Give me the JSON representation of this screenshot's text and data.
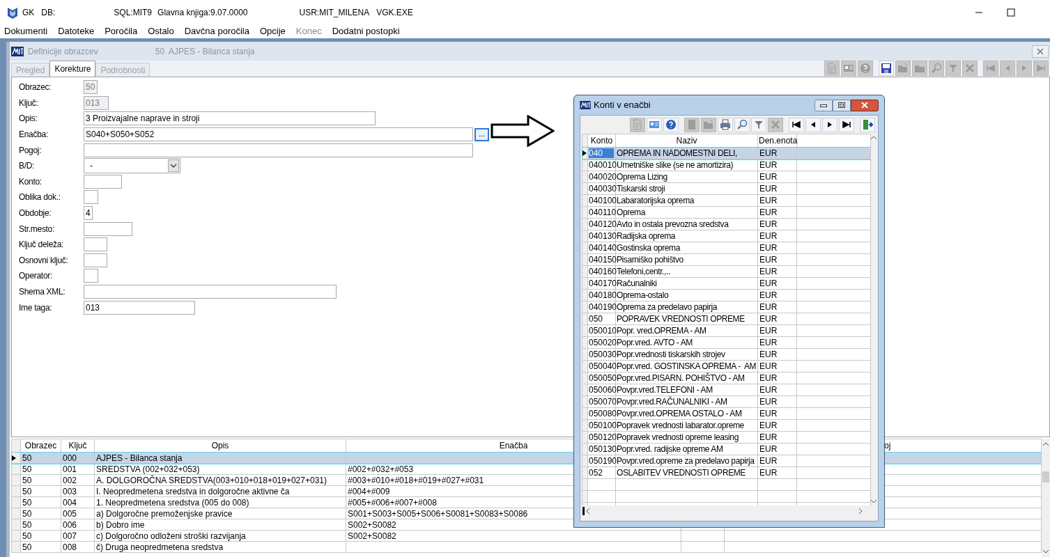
{
  "app_window": {
    "title_parts": [
      "GK",
      "DB:",
      "SQL:MIT9",
      "Glavna knjiga:9.07.0000",
      "USR:MIT_MILENA",
      "VGK.EXE"
    ]
  },
  "menu": [
    {
      "label": "Dokumenti",
      "disabled": false
    },
    {
      "label": "Datoteke",
      "disabled": false
    },
    {
      "label": "Poročila",
      "disabled": false
    },
    {
      "label": "Ostalo",
      "disabled": false
    },
    {
      "label": "Davčna poročila",
      "disabled": false
    },
    {
      "label": "Opcije",
      "disabled": false
    },
    {
      "label": "Konec",
      "disabled": true
    },
    {
      "label": "Dodatni postopki",
      "disabled": false
    }
  ],
  "child_window": {
    "title": "Definicije obrazcev",
    "subtitle": "50  AJPES - Bilanca stanja",
    "tabs": [
      {
        "label": "Pregled",
        "selected": false,
        "disabled": true
      },
      {
        "label": "Korekture",
        "selected": true,
        "disabled": false
      },
      {
        "label": "Podrobnosti",
        "selected": false,
        "disabled": true
      }
    ],
    "toolbar_groups": [
      {
        "buttons": [
          {
            "kind": "document",
            "disabled": true
          },
          {
            "kind": "card",
            "disabled": true
          },
          {
            "kind": "help",
            "disabled": true
          }
        ]
      },
      {
        "buttons": [
          {
            "kind": "save",
            "disabled": false
          },
          {
            "kind": "folder_open",
            "disabled": true
          },
          {
            "kind": "folder",
            "disabled": true
          },
          {
            "kind": "search",
            "disabled": true
          },
          {
            "kind": "filter",
            "disabled": true
          },
          {
            "kind": "delete",
            "disabled": true
          }
        ]
      },
      {
        "buttons": [
          {
            "kind": "first",
            "disabled": true
          },
          {
            "kind": "prev",
            "disabled": true
          },
          {
            "kind": "next",
            "disabled": true
          },
          {
            "kind": "last",
            "disabled": true
          }
        ]
      }
    ]
  },
  "form": {
    "fields": [
      {
        "label": "Obrazec:",
        "value": "50",
        "kind": "text",
        "readonly": true
      },
      {
        "label": "Ključ:",
        "value": "013",
        "kind": "text",
        "readonly": true
      },
      {
        "label": "Opis:",
        "value": "3 Proizvajalne naprave in stroji",
        "kind": "text",
        "readonly": false
      },
      {
        "label": "Enačba:",
        "value": "S040+S050+S052",
        "kind": "text_button",
        "button_label": "...",
        "readonly": false
      },
      {
        "label": "Pogoj:",
        "kind": "text",
        "readonly": false
      },
      {
        "label": "B/D:",
        "value": "-",
        "kind": "combo",
        "readonly": false
      },
      {
        "label": "Konto:",
        "kind": "text",
        "readonly": false
      },
      {
        "label": "Oblika dok.:",
        "kind": "text",
        "readonly": false
      },
      {
        "label": "Obdobje:",
        "value": "4",
        "kind": "text",
        "readonly": false
      },
      {
        "label": "Str.mesto:",
        "kind": "text",
        "readonly": false
      },
      {
        "label": "Ključ deleža:",
        "kind": "text",
        "readonly": false
      },
      {
        "label": "Osnovni ključ:",
        "kind": "text",
        "readonly": false
      },
      {
        "label": "Operator:",
        "kind": "text",
        "readonly": false
      },
      {
        "label": "Shema XML:",
        "kind": "text",
        "readonly": false
      },
      {
        "label": "Ime taga:",
        "value": "013",
        "kind": "text",
        "readonly": false
      }
    ]
  },
  "grid": {
    "columns": [
      "Obrazec",
      "Ključ",
      "Opis",
      "Enačba"
    ],
    "column_6_header": "oj",
    "rows": [
      {
        "obrazec": "50",
        "kljuc": "000",
        "opis": "AJPES - Bilanca stanja",
        "selected": true
      },
      {
        "obrazec": "50",
        "kljuc": "001",
        "opis": "SREDSTVA (002+032+053)",
        "enacba": "#002+#032+#053",
        "selected": false
      },
      {
        "obrazec": "50",
        "kljuc": "002",
        "opis": "A. DOLGOROČNA SREDSTVA(003+010+018+019+027+031)",
        "enacba": "#003+#010+#018+#019+#027+#031",
        "selected": false
      },
      {
        "obrazec": "50",
        "kljuc": "003",
        "opis": "I. Neopredmetena sredstva in dolgoročne aktivne ča",
        "enacba": "#004+#009",
        "selected": false
      },
      {
        "obrazec": "50",
        "kljuc": "004",
        "opis": "1. Neopredmetena sredstva (005 do 008)",
        "enacba": "#005+#006+#007+#008",
        "selected": false
      },
      {
        "obrazec": "50",
        "kljuc": "005",
        "opis": "a) Dolgoročne premoženjske pravice",
        "enacba": "S001+S003+S005+S006+S0081+S0083+S0086",
        "selected": false
      },
      {
        "obrazec": "50",
        "kljuc": "006",
        "opis": "b) Dobro ime",
        "enacba": "S002+S0082",
        "selected": false
      },
      {
        "obrazec": "50",
        "kljuc": "007",
        "opis": "c) Dolgoročno odloženi stroški razvijanja",
        "enacba": "S002+S0082",
        "selected": false
      },
      {
        "obrazec": "50",
        "kljuc": "008",
        "opis": "č) Druga neopredmetena sredstva",
        "selected": false
      }
    ]
  },
  "dialog": {
    "title": "Konti v enačbi",
    "toolbar_groups": [
      {
        "buttons": [
          {
            "kind": "document",
            "disabled": true
          },
          {
            "kind": "card",
            "disabled": false
          },
          {
            "kind": "help",
            "disabled": false
          }
        ]
      },
      {
        "buttons": [
          {
            "kind": "new",
            "disabled": true
          },
          {
            "kind": "folder_open",
            "disabled": true
          },
          {
            "kind": "print",
            "disabled": false
          },
          {
            "kind": "search",
            "disabled": false
          },
          {
            "kind": "filter",
            "disabled": false
          },
          {
            "kind": "delete",
            "disabled": true
          }
        ]
      },
      {
        "buttons": [
          {
            "kind": "first",
            "disabled": false
          },
          {
            "kind": "prev",
            "disabled": false
          },
          {
            "kind": "next",
            "disabled": false
          },
          {
            "kind": "last",
            "disabled": false
          }
        ]
      },
      {
        "buttons": [
          {
            "kind": "exit",
            "disabled": false
          }
        ]
      }
    ],
    "columns": [
      "Konto",
      "Naziv",
      "Den.enota"
    ],
    "rows": [
      {
        "konto": "040",
        "naziv": "OPREMA IN NADOMESTNI DELI,",
        "enota": "EUR",
        "selected": true
      },
      {
        "konto": "040010",
        "naziv": "Umetniške slike (se ne amortizira)",
        "enota": "EUR",
        "selected": false
      },
      {
        "konto": "040020",
        "naziv": "Oprema Lizing",
        "enota": "EUR",
        "selected": false
      },
      {
        "konto": "040030",
        "naziv": "Tiskarski stroji",
        "enota": "EUR",
        "selected": false
      },
      {
        "konto": "040100",
        "naziv": "Labaratorijska oprema",
        "enota": "EUR",
        "selected": false
      },
      {
        "konto": "040110",
        "naziv": "Oprema",
        "enota": "EUR",
        "selected": false
      },
      {
        "konto": "040120",
        "naziv": "Avto in ostala prevozna sredstva",
        "enota": "EUR",
        "selected": false
      },
      {
        "konto": "040130",
        "naziv": "Radijska oprema",
        "enota": "EUR",
        "selected": false
      },
      {
        "konto": "040140",
        "naziv": "Gostinska oprema",
        "enota": "EUR",
        "selected": false
      },
      {
        "konto": "040150",
        "naziv": "Pisarniško pohištvo",
        "enota": "EUR",
        "selected": false
      },
      {
        "konto": "040160",
        "naziv": "Telefoni,centr.,..",
        "enota": "EUR",
        "selected": false
      },
      {
        "konto": "040170",
        "naziv": "Računalniki",
        "enota": "EUR",
        "selected": false
      },
      {
        "konto": "040180",
        "naziv": "Oprema-ostalo",
        "enota": "EUR",
        "selected": false
      },
      {
        "konto": "040190",
        "naziv": "Oprema za predelavo papirja",
        "enota": "EUR",
        "selected": false
      },
      {
        "konto": "050",
        "naziv": "POPRAVEK VREDNOSTI OPREME",
        "enota": "EUR",
        "selected": false
      },
      {
        "konto": "050010",
        "naziv": "Popr. vred.OPREMA - AM",
        "enota": "EUR",
        "selected": false
      },
      {
        "konto": "050020",
        "naziv": "Popr.vred. AVTO - AM",
        "enota": "EUR",
        "selected": false
      },
      {
        "konto": "050030",
        "naziv": "Popr.vrednosti tiskarskih strojev",
        "enota": "EUR",
        "selected": false
      },
      {
        "konto": "050040",
        "naziv": "Popr.vred. GOSTINSKA OPREMA -  AM",
        "enota": "EUR",
        "selected": false
      },
      {
        "konto": "050050",
        "naziv": "Popr.vred.PISARN. POHIŠTVO - AM",
        "enota": "EUR",
        "selected": false
      },
      {
        "konto": "050060",
        "naziv": "Povpr.vred.TELEFONI - AM",
        "enota": "EUR",
        "selected": false
      },
      {
        "konto": "050070",
        "naziv": "Povpr.vred.RAČUNALNIKI - AM",
        "enota": "EUR",
        "selected": false
      },
      {
        "konto": "050080",
        "naziv": "Povpr.vred.OPREMA OSTALO - AM",
        "enota": "EUR",
        "selected": false
      },
      {
        "konto": "050100",
        "naziv": "Popravek vrednosti labarator.opreme",
        "enota": "EUR",
        "selected": false
      },
      {
        "konto": "050120",
        "naziv": "Popravek vrednosti opreme leasing",
        "enota": "EUR",
        "selected": false
      },
      {
        "konto": "050130",
        "naziv": "Popr.vred. radijske opreme AM",
        "enota": "EUR",
        "selected": false
      },
      {
        "konto": "050190",
        "naziv": "Povpr.vred.opreme za predelavo papirja",
        "enota": "EUR",
        "selected": false
      },
      {
        "konto": "052",
        "naziv": "OSLABITEV VREDNOSTI OPREME",
        "enota": "EUR",
        "selected": false
      }
    ]
  }
}
